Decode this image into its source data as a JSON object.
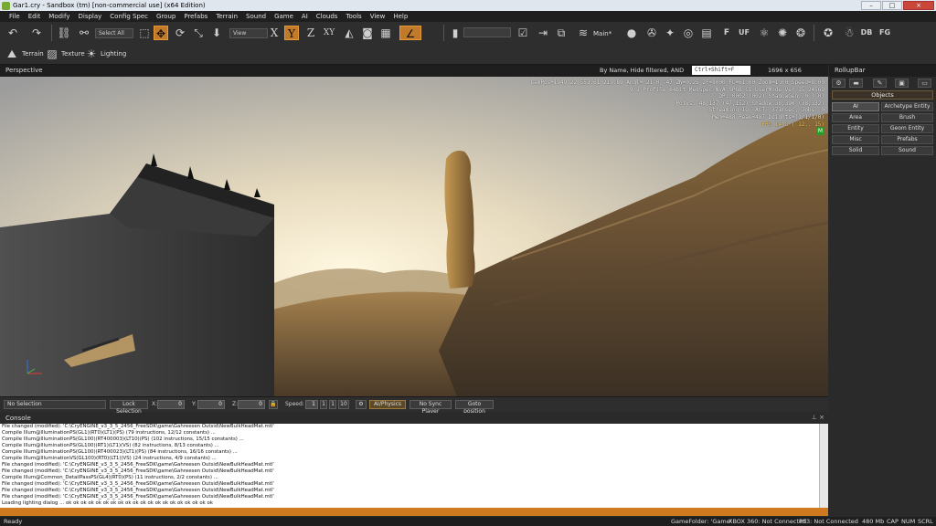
{
  "window": {
    "title": "Gar1.cry - Sandbox (tm) [non-commercial use] (x64 Edition)",
    "buttons": [
      "–",
      "□",
      "×"
    ]
  },
  "menu": [
    "File",
    "Edit",
    "Modify",
    "Display",
    "Config Spec",
    "Group",
    "Prefabs",
    "Terrain",
    "Sound",
    "Game",
    "AI",
    "Clouds",
    "Tools",
    "View",
    "Help"
  ],
  "toolbar": {
    "select_all": "Select All",
    "ref_coord": "View",
    "axis_x": "X",
    "axis_y": "Y",
    "axis_z": "Z",
    "axis_xy": "XY",
    "layer": "Main*",
    "f_label": "F",
    "uf_label": "UF",
    "db_label": "DB",
    "fg_label": "FG"
  },
  "toolbar2": {
    "terrain": "Terrain",
    "texture": "Texture",
    "lighting": "Lighting"
  },
  "viewport": {
    "name": "Perspective",
    "filter_text": "By Name, Hide filtered, AND",
    "search_placeholder": "Ctrl+Shift+F",
    "resolution": "1696 x 656",
    "stats": [
      "CamPos=1949.22 553.61 219.89 Angl= 21  0 -47 ZN=0.25 ZF=8000 FC=61.00 Zoom=1.00 Speed=8.00",
      "9/9 Profile 64bit MedSpec NVA SPGB C1 UserMode Ver 15 2456D",
      "DP: 0002 (002) ShadowGen: 0 (  0)",
      "Polys: 48,137 (47,152) Shadow:38,390 (38,332)",
      "Streaming IO: ACT: 371msec, Jobs: 0",
      "Mem=488 Peak=487 DLights=(1/1/1/0)"
    ],
    "fps": "FPS 14.8 ( 12.. 15)",
    "m_badge": "M"
  },
  "rollup": {
    "title": "RollupBar",
    "tabs": [
      "⚙",
      "▬",
      "✎",
      "▣",
      "▭"
    ],
    "section": "Objects",
    "buttons": [
      [
        "AI",
        "Archetype Entity"
      ],
      [
        "Area",
        "Brush"
      ],
      [
        "Entity",
        "Geom Entity"
      ],
      [
        "Misc",
        "Prefabs"
      ],
      [
        "Solid",
        "Sound"
      ]
    ]
  },
  "strip": {
    "selection": "No Selection",
    "lock": "Lock Selection",
    "x_label": "X:",
    "y_label": "Y:",
    "z_label": "Z:",
    "x_val": "0",
    "y_val": "0",
    "z_val": "0",
    "speed_label": "Speed:",
    "speed_val": "1",
    "speed_presets": [
      "1",
      "1",
      "10"
    ],
    "ai_physics": "AI/Physics",
    "no_sync": "No Sync Player",
    "goto": "Goto position"
  },
  "console": {
    "title": "Console",
    "lines": [
      "File changed (modified): 'C:\\CryENGINE_v3_3_5_2456_FreeSDK\\game\\Gahreesen Outsid\\NewBulkHeadMat.mtl'",
      " Compile Illum@IlluminationPS(GL1)(RT0)(LT1)(PS) (79 instructions, 12/12 constants) ...",
      " Compile Illum@IlluminationPS(GL100)(RT400003)(LT10)(PS) (102 instructions, 15/15 constants) ...",
      " Compile Illum@IlluminationPS(GL100)(RT1)(LT1)(VS) (82 instructions, 8/13 constants) ...",
      " Compile Illum@IlluminationPS(GL100)(RT400023)(LT1)(PS) (84 instructions, 16/16 constants) ...",
      " Compile Illum@IlluminationVS(GL100)(RT0)(LT1)(VS) (24 instructions, 4/9 constants) ...",
      "File changed (modified): 'C:\\CryENGINE_v3_3_5_2456_FreeSDK\\game\\Gahreesen Outsid\\NewBulkHeadMat.mtl'",
      "File changed (modified): 'C:\\CryENGINE_v3_3_5_2456_FreeSDK\\game\\Gahreesen Outsid\\NewBulkHeadMat.mtl'",
      " Compile Illum@Common_DetailPassPS(GL4)(RT0)(PS) (11 instructions, 2/2 constants) ...",
      "File changed (modified): 'C:\\CryENGINE_v3_3_5_2456_FreeSDK\\game\\Gahreesen Outsid\\NewBulkHeadMat.mtl'",
      "File changed (modified): 'C:\\CryENGINE_v3_3_5_2456_FreeSDK\\game\\Gahreesen Outsid\\NewBulkHeadMat.mtl'",
      "File changed (modified): 'C:\\CryENGINE_v3_3_5_2456_FreeSDK\\game\\Gahreesen Outsid\\NewBulkHeadMat.mtl'",
      "Loading lighting dialog ... ok ok ok ok ok ok ok ok ok ok ok ok ok ok ok ok ok ok ok ok"
    ]
  },
  "statusbar": {
    "ready": "Ready",
    "game_folder": "GameFolder: 'Game'",
    "xbox": "XBOX 360: Not Connected",
    "ps3": "PS3: Not Connected",
    "mem": "480 Mb",
    "cap": "CAP",
    "num": "NUM",
    "scrl": "SCRL"
  }
}
